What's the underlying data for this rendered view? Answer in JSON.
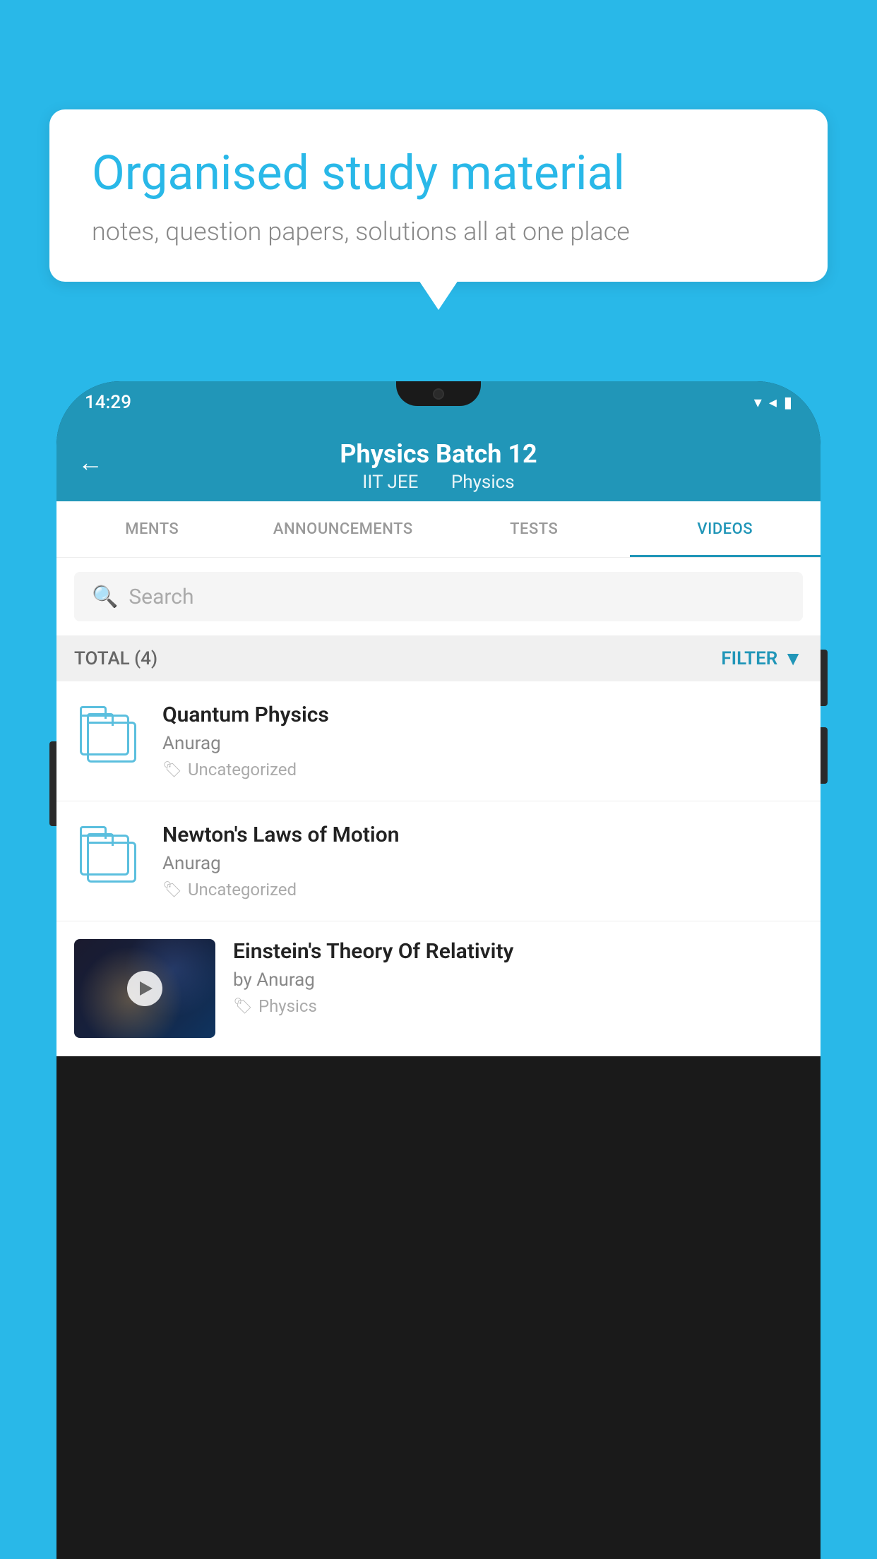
{
  "background_color": "#29b8e8",
  "speech_bubble": {
    "title": "Organised study material",
    "subtitle": "notes, question papers, solutions all at one place"
  },
  "phone": {
    "status_bar": {
      "time": "14:29",
      "icons": "▾◂▮"
    },
    "app_bar": {
      "title": "Physics Batch 12",
      "subtitle_parts": [
        "IIT JEE",
        "Physics"
      ],
      "back_label": "←"
    },
    "tabs": [
      {
        "label": "MENTS",
        "active": false
      },
      {
        "label": "ANNOUNCEMENTS",
        "active": false
      },
      {
        "label": "TESTS",
        "active": false
      },
      {
        "label": "VIDEOS",
        "active": true
      }
    ],
    "search": {
      "placeholder": "Search"
    },
    "filter_bar": {
      "total_label": "TOTAL (4)",
      "filter_label": "FILTER"
    },
    "videos": [
      {
        "title": "Quantum Physics",
        "author": "Anurag",
        "tag": "Uncategorized",
        "has_thumbnail": false
      },
      {
        "title": "Newton's Laws of Motion",
        "author": "Anurag",
        "tag": "Uncategorized",
        "has_thumbnail": false
      },
      {
        "title": "Einstein's Theory Of Relativity",
        "author": "by Anurag",
        "tag": "Physics",
        "has_thumbnail": true
      }
    ]
  }
}
